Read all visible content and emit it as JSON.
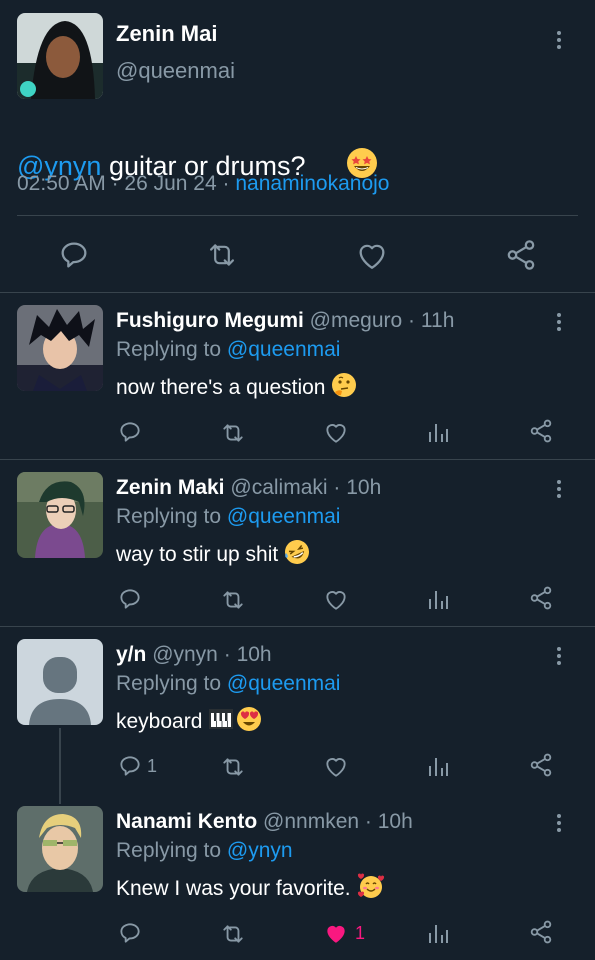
{
  "main_tweet": {
    "author_name": "Zenin Mai",
    "handle": "@queenmai",
    "mention": "@ynyn",
    "text": " guitar or drums?",
    "time": "02:50 AM",
    "date": "26 Jun 24",
    "separator": "·",
    "source": "nanaminokanojo"
  },
  "replies": [
    {
      "name": "Fushiguro Megumi",
      "handle": "@meguro",
      "time": "11h",
      "replying_prefix": "Replying to",
      "replying_to": "@queenmai",
      "text": "now there's a question",
      "emoji": "thinking-face",
      "reply_count": "",
      "like_count": ""
    },
    {
      "name": "Zenin Maki",
      "handle": "@calimaki",
      "time": "10h",
      "replying_prefix": "Replying to",
      "replying_to": "@queenmai",
      "text": "way to stir up shit",
      "emoji": "rolling-laughing-face",
      "reply_count": "",
      "like_count": ""
    },
    {
      "name": "y/n",
      "handle": "@ynyn",
      "time": "10h",
      "replying_prefix": "Replying to",
      "replying_to": "@queenmai",
      "text": "keyboard",
      "emoji": "piano-and-heart-eyes",
      "reply_count": "1",
      "like_count": ""
    },
    {
      "name": "Nanami Kento",
      "handle": "@nnmken",
      "time": "10h",
      "replying_prefix": "Replying to",
      "replying_to": "@ynyn",
      "text": "Knew I was your favorite.",
      "emoji": "smiling-face-with-hearts",
      "reply_count": "",
      "like_count": "1",
      "liked": true
    }
  ],
  "colors": {
    "background": "#15202b",
    "text": "#ffffff",
    "muted": "#8899a6",
    "accent": "#1d9bf0",
    "like": "#f91880",
    "divider": "#38444d"
  }
}
